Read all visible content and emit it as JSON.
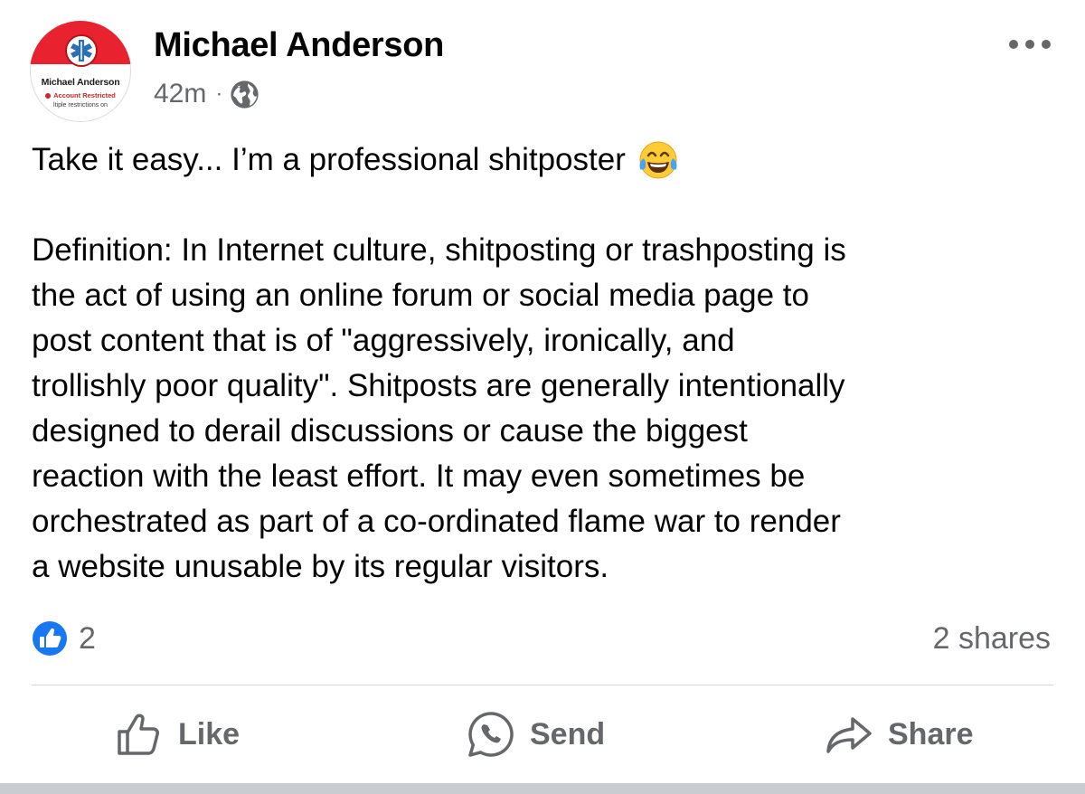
{
  "post": {
    "author": {
      "name": "Michael Anderson",
      "avatar": {
        "name": "Michael Anderson",
        "status": "Account Restricted",
        "subtext": "ltiple restrictions on"
      }
    },
    "timestamp": "42m",
    "separator": "·",
    "audience_icon": "globe-icon",
    "more_icon": "more-options-icon",
    "body": {
      "line1": "Take it easy... I’m a professional shitposter",
      "emoji": "face-with-tears-of-joy",
      "paragraph": [
        "Definition: In Internet culture, shitposting or trashposting is",
        "the act of using an online forum or social media page to",
        "post content that is of \"aggressively, ironically, and",
        "trollishly poor quality\". Shitposts are generally intentionally",
        "designed to derail discussions or cause the biggest",
        "reaction with the least effort. It may even sometimes be",
        "orchestrated as part of a co-ordinated flame war to render",
        "a website unusable by its regular visitors."
      ]
    },
    "reactions": {
      "icon": "thumbs-up-icon",
      "count": "2"
    },
    "shares": "2 shares",
    "actions": {
      "like": "Like",
      "send": "Send",
      "share": "Share"
    }
  },
  "colors": {
    "text": "#050505",
    "secondary": "#65676b",
    "like_blue": "#1877f2",
    "avatar_red": "#e8232f",
    "divider": "#d4d6da"
  }
}
